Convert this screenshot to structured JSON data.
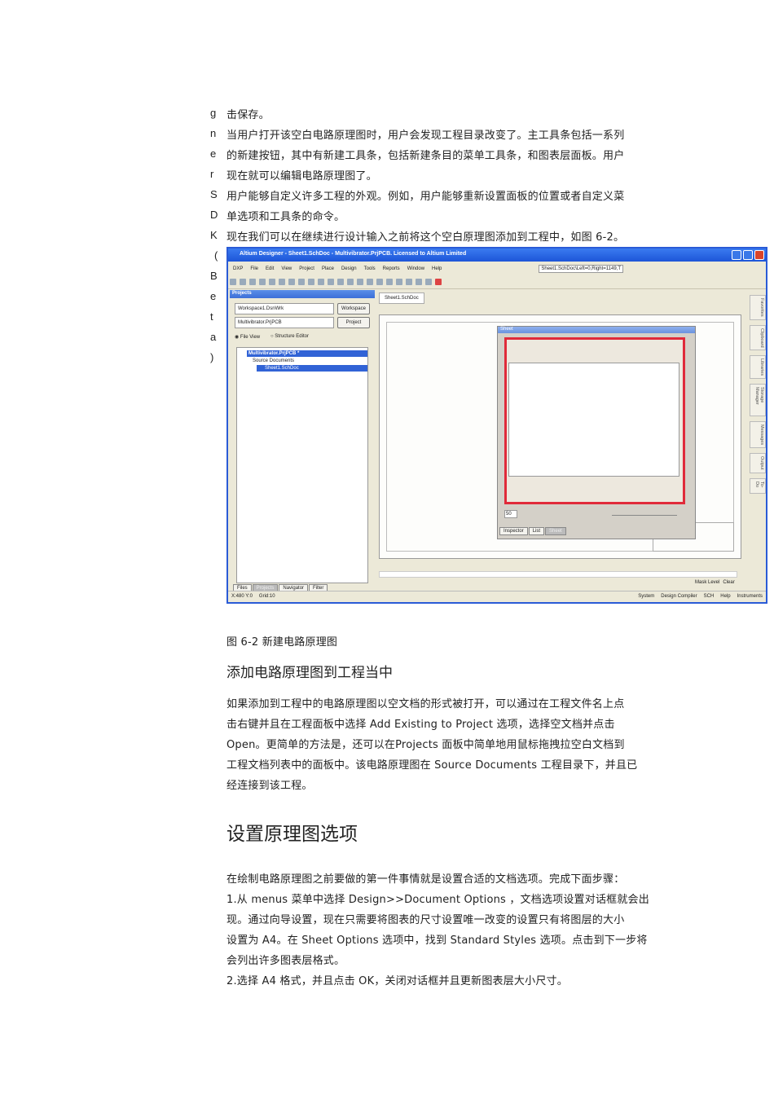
{
  "side_letters": [
    "g",
    "n",
    "e",
    "r",
    "S",
    "D",
    "K",
    "(",
    "B",
    "e",
    "t",
    "a",
    ")"
  ],
  "intro_lines": [
    "击保存。",
    "当用户打开该空白电路原理图时，用户会发现工程目录改变了。主工具条包括一系列",
    "的新建按钮，其中有新建工具条，包括新建条目的菜单工具条，和图表层面板。用户",
    "现在就可以编辑电路原理图了。",
    "用户能够自定义许多工程的外观。例如，用户能够重新设置面板的位置或者自定义菜",
    "单选项和工具条的命令。",
    "现在我们可以在继续进行设计输入之前将这个空白原理图添加到工程中，如图 6-2。"
  ],
  "screenshot": {
    "title": "Altium Designer - Sheet1.SchDoc - Multivibrator.PrjPCB. Licensed to Altium Limited",
    "menu": [
      "DXP",
      "File",
      "Edit",
      "View",
      "Project",
      "Place",
      "Design",
      "Tools",
      "Reports",
      "Window",
      "Help"
    ],
    "toolbar_combo": "Sheet1.SchDoc\\Left=0,Right=1149,T",
    "projects_panel": {
      "header": "Projects",
      "workspace_value": "Workspace1.DsnWrk",
      "workspace_button": "Workspace",
      "project_value": "Multivibrator.PrjPCB",
      "project_button": "Project",
      "radio_file_view": "File View",
      "radio_structure": "Structure Editor",
      "tree": [
        "Multivibrator.PrjPCB *",
        "Source Documents",
        "Sheet1.SchDoc"
      ],
      "bottom_tabs": [
        "Files",
        "Projects",
        "Navigator",
        "Filter"
      ]
    },
    "doc_tab": "Sheet1.SchDoc",
    "sheet_panel": {
      "title": "Sheet",
      "zoom_value": "50",
      "tabs": [
        "Inspector",
        "List",
        "Sheet"
      ]
    },
    "right_tabs": [
      "Favorites",
      "Clipboard",
      "Libraries",
      "Storage Manager",
      "Messages",
      "Output",
      "To-Do"
    ],
    "mask": [
      "Mask Level",
      "Clear"
    ],
    "status_left": [
      "X:480 Y:0",
      "Grid:10"
    ],
    "status_right": [
      "System",
      "Design Compiler",
      "SCH",
      "Help",
      "Instruments"
    ]
  },
  "caption": "图 6-2 新建电路原理图",
  "section1_title": "添加电路原理图到工程当中",
  "section1_lines": [
    "如果添加到工程中的电路原理图以空文档的形式被打开，可以通过在工程文件名上点",
    "击右键并且在工程面板中选择 Add Existing to Project 选项，选择空文档并点击",
    "Open。更简单的方法是，还可以在Projects 面板中简单地用鼠标拖拽拉空白文档到",
    "工程文档列表中的面板中。该电路原理图在 Source Documents 工程目录下，并且已",
    "经连接到该工程。"
  ],
  "section2_title": "设置原理图选项",
  "section2_lines": [
    "在绘制电路原理图之前要做的第一件事情就是设置合适的文档选项。完成下面步骤：",
    "1.从 menus 菜单中选择 Design>>Document Options ，文档选项设置对话框就会出",
    "现。通过向导设置，现在只需要将图表的尺寸设置唯一改变的设置只有将图层的大小",
    "设置为 A4。在 Sheet Options 选项中，找到 Standard Styles 选项。点击到下一步将",
    "会列出许多图表层格式。",
    "2.选择 A4 格式，并且点击 OK，关闭对话框并且更新图表层大小尺寸。"
  ]
}
